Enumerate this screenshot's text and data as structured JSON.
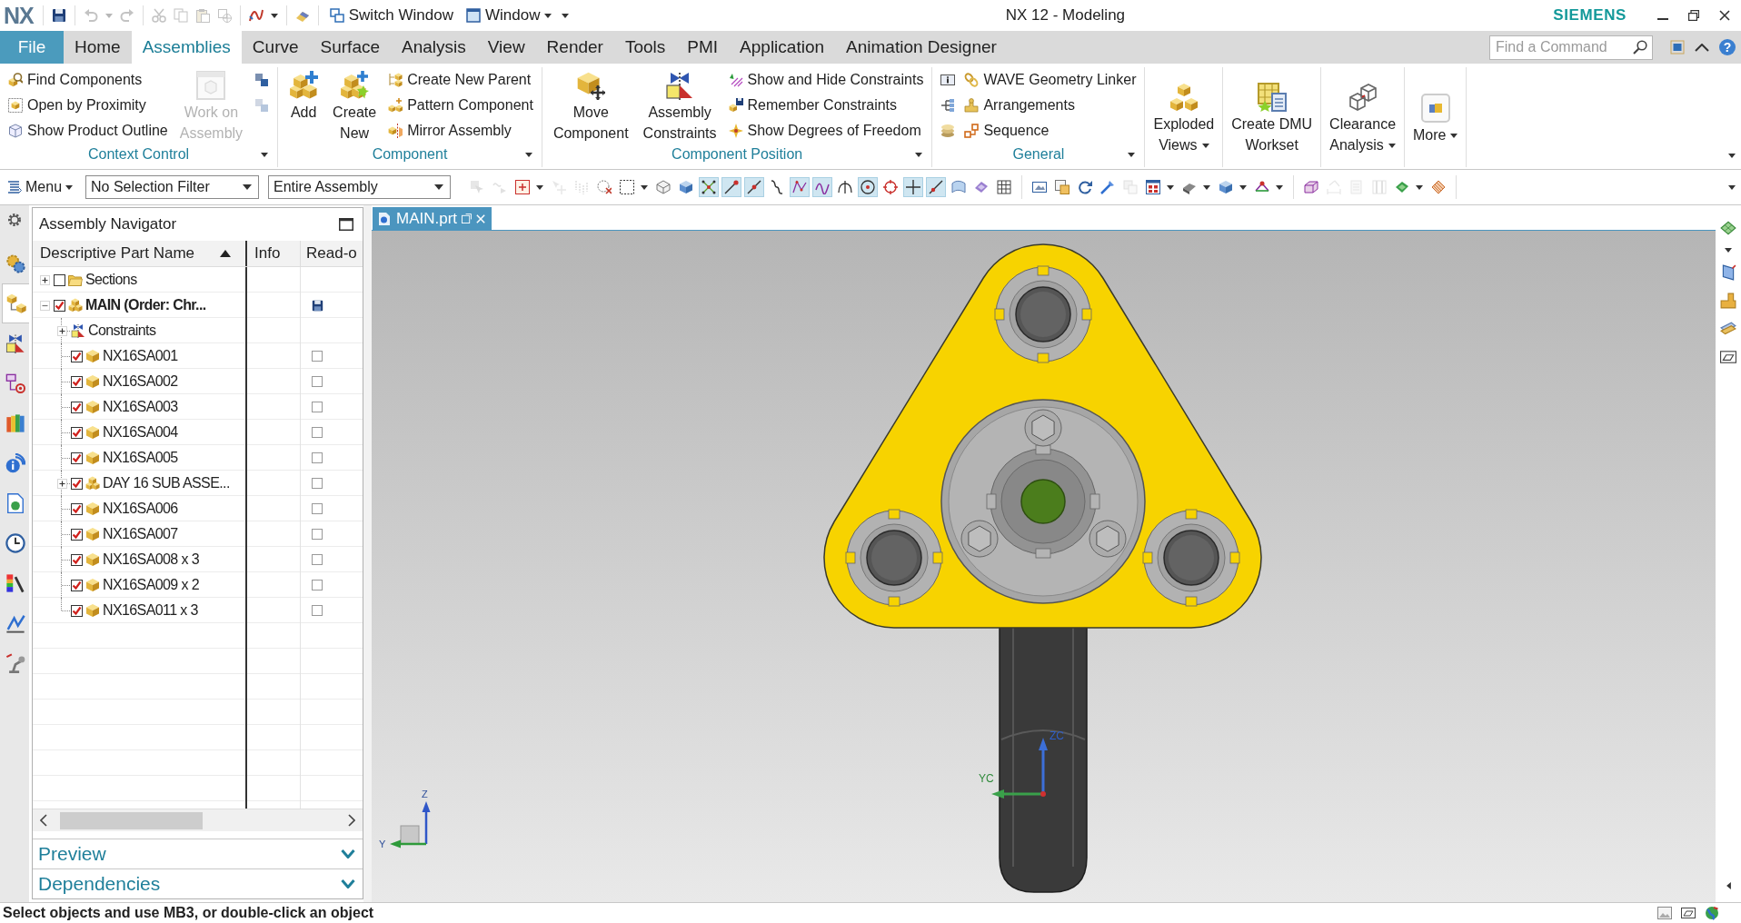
{
  "title_bar": {
    "logo": "NX",
    "quick_access": [
      {
        "tools": [
          {
            "kind": "plain",
            "disabled": false
          }
        ]
      },
      {
        "tools": [
          {
            "kind": "split",
            "disabled": true
          },
          {
            "kind": "plain",
            "disabled": true
          }
        ]
      },
      {
        "tools": [
          {
            "kind": "plain",
            "disabled": true
          },
          {
            "kind": "plain",
            "disabled": true
          },
          {
            "kind": "plain",
            "disabled": true
          },
          {
            "kind": "plain",
            "disabled": true
          }
        ]
      },
      {
        "tools": [
          {
            "kind": "split",
            "disabled": false
          }
        ]
      },
      {
        "tools": [
          {
            "kind": "plain",
            "disabled": false
          }
        ]
      }
    ],
    "window_menu": [
      {
        "label": "Switch Window",
        "kind": "plain"
      },
      {
        "label": "Window",
        "kind": "split"
      }
    ],
    "title": "NX 12 - Modeling",
    "brand": "SIEMENS"
  },
  "ribbon": {
    "tabs": [
      {
        "label": "File",
        "kind": "backstage",
        "selected": false
      },
      {
        "label": "Home",
        "kind": "tab",
        "selected": false
      },
      {
        "label": "Assemblies",
        "kind": "tab",
        "selected": true
      },
      {
        "label": "Curve",
        "kind": "tab",
        "selected": false
      },
      {
        "label": "Surface",
        "kind": "tab",
        "selected": false
      },
      {
        "label": "Analysis",
        "kind": "tab",
        "selected": false
      },
      {
        "label": "View",
        "kind": "tab",
        "selected": false
      },
      {
        "label": "Render",
        "kind": "tab",
        "selected": false
      },
      {
        "label": "Tools",
        "kind": "tab",
        "selected": false
      },
      {
        "label": "PMI",
        "kind": "tab",
        "selected": false
      },
      {
        "label": "Application",
        "kind": "tab",
        "selected": false
      },
      {
        "label": "Animation Designer",
        "kind": "tab",
        "selected": false
      }
    ],
    "search": {
      "placeholder": "Find a Command"
    },
    "help": "?",
    "groups": [
      {
        "label": "Context Control",
        "items": [
          {
            "kind": "small",
            "label": "Find Components",
            "disabled": false
          },
          {
            "kind": "small",
            "label": "Open by Proximity",
            "disabled": false
          },
          {
            "kind": "small",
            "label": "Show Product Outline",
            "disabled": false
          },
          {
            "kind": "large",
            "label": "Work on\nAssembly",
            "disabled": true
          },
          {
            "kind": "icon",
            "disabled": false
          },
          {
            "kind": "icon",
            "disabled": true
          }
        ]
      },
      {
        "label": "Component",
        "items": [
          {
            "kind": "large",
            "label": "Add",
            "disabled": false
          },
          {
            "kind": "large",
            "label": "Create\nNew",
            "disabled": false
          },
          {
            "kind": "small",
            "label": "Create New Parent",
            "disabled": false
          },
          {
            "kind": "small",
            "label": "Pattern Component",
            "disabled": false
          },
          {
            "kind": "small",
            "label": "Mirror Assembly",
            "disabled": false
          }
        ]
      },
      {
        "label": "Component Position",
        "items": [
          {
            "kind": "large",
            "label": "Move\nComponent",
            "disabled": false
          },
          {
            "kind": "large",
            "label": "Assembly\nConstraints",
            "disabled": false
          },
          {
            "kind": "small",
            "label": "Show and Hide Constraints",
            "disabled": false
          },
          {
            "kind": "small",
            "label": "Remember Constraints",
            "disabled": false
          },
          {
            "kind": "small",
            "label": "Show Degrees of Freedom",
            "disabled": false
          }
        ]
      },
      {
        "label": "General",
        "items": [
          {
            "kind": "icon",
            "disabled": false
          },
          {
            "kind": "icon",
            "disabled": false
          },
          {
            "kind": "icon",
            "disabled": false
          },
          {
            "kind": "small",
            "label": "WAVE Geometry Linker",
            "disabled": false
          },
          {
            "kind": "small",
            "label": "Arrangements",
            "disabled": false
          },
          {
            "kind": "small",
            "label": "Sequence",
            "disabled": false
          }
        ]
      }
    ],
    "large_buttons": [
      {
        "label": "Exploded\nViews",
        "menu": true
      },
      {
        "label": "Create DMU\nWorkset",
        "menu": false
      },
      {
        "label": "Clearance\nAnalysis",
        "menu": true
      },
      {
        "label": "More",
        "menu": true
      }
    ]
  },
  "toolbar": {
    "menu": "Menu",
    "filters": [
      {
        "value": "No Selection Filter"
      },
      {
        "value": "Entire Assembly"
      }
    ],
    "groups": [
      {
        "tools": [
          {
            "kind": "plain",
            "on": false,
            "disabled": true
          },
          {
            "kind": "plain",
            "on": false,
            "disabled": true
          },
          {
            "kind": "split",
            "on": false,
            "disabled": false
          },
          {
            "kind": "plain",
            "on": false,
            "disabled": true
          },
          {
            "kind": "plain",
            "on": false,
            "disabled": true
          },
          {
            "kind": "plain",
            "on": false,
            "disabled": false
          },
          {
            "kind": "split",
            "on": false,
            "disabled": false
          },
          {
            "kind": "plain",
            "on": false,
            "disabled": false
          },
          {
            "kind": "plain",
            "on": false,
            "disabled": false
          },
          {
            "kind": "plain",
            "on": true,
            "disabled": false
          },
          {
            "kind": "plain",
            "on": true,
            "disabled": false
          },
          {
            "kind": "plain",
            "on": true,
            "disabled": false
          },
          {
            "kind": "plain",
            "on": false,
            "disabled": false
          },
          {
            "kind": "plain",
            "on": true,
            "disabled": false
          },
          {
            "kind": "plain",
            "on": true,
            "disabled": false
          },
          {
            "kind": "plain",
            "on": false,
            "disabled": false
          },
          {
            "kind": "plain",
            "on": true,
            "disabled": false
          },
          {
            "kind": "plain",
            "on": false,
            "disabled": false
          },
          {
            "kind": "plain",
            "on": true,
            "disabled": false
          },
          {
            "kind": "plain",
            "on": true,
            "disabled": false
          },
          {
            "kind": "plain",
            "on": false,
            "disabled": false
          },
          {
            "kind": "plain",
            "on": false,
            "disabled": false
          },
          {
            "kind": "plain",
            "on": false,
            "disabled": false
          }
        ]
      },
      {
        "tools": [
          {
            "kind": "plain",
            "on": false,
            "disabled": false
          },
          {
            "kind": "plain",
            "on": false,
            "disabled": false
          },
          {
            "kind": "plain",
            "on": false,
            "disabled": false
          },
          {
            "kind": "plain",
            "on": false,
            "disabled": false
          },
          {
            "kind": "plain",
            "on": false,
            "disabled": true
          },
          {
            "kind": "split",
            "on": false,
            "disabled": false
          },
          {
            "kind": "split",
            "on": false,
            "disabled": false
          },
          {
            "kind": "split",
            "on": false,
            "disabled": false
          },
          {
            "kind": "split",
            "on": false,
            "disabled": false
          }
        ]
      },
      {
        "tools": [
          {
            "kind": "plain",
            "on": false,
            "disabled": false
          },
          {
            "kind": "plain",
            "on": false,
            "disabled": true
          },
          {
            "kind": "plain",
            "on": false,
            "disabled": true
          },
          {
            "kind": "plain",
            "on": false,
            "disabled": true
          },
          {
            "kind": "split",
            "on": false,
            "disabled": false
          },
          {
            "kind": "plain",
            "on": false,
            "disabled": false
          }
        ]
      }
    ]
  },
  "resource_bar": {
    "items": [
      {
        "selected": false
      },
      {
        "selected": true
      },
      {
        "selected": false
      },
      {
        "selected": false
      },
      {
        "selected": false
      },
      {
        "selected": false
      },
      {
        "selected": false
      },
      {
        "selected": false
      },
      {
        "selected": false
      },
      {
        "selected": false
      },
      {
        "selected": false
      }
    ]
  },
  "navigator": {
    "title": "Assembly Navigator",
    "columns": [
      {
        "label": "Descriptive Part Name",
        "sorted": true
      },
      {
        "label": "Info",
        "sorted": false
      },
      {
        "label": "Read-o",
        "sorted": false
      }
    ],
    "tree": [
      {
        "name": "Sections",
        "kind": "folder",
        "checked": false,
        "expanded": false,
        "work_part": false
      },
      {
        "name": "MAIN (Order: Chr...",
        "kind": "assembly",
        "checked": true,
        "expanded": true,
        "work_part": true,
        "modified": true,
        "children": [
          {
            "name": "Constraints",
            "kind": "constraints",
            "expanded": false,
            "work_part": false
          },
          {
            "name": "NX16SA001",
            "kind": "part",
            "checked": true,
            "work_part": false,
            "modified": false
          },
          {
            "name": "NX16SA002",
            "kind": "part",
            "checked": true,
            "work_part": false,
            "modified": false
          },
          {
            "name": "NX16SA003",
            "kind": "part",
            "checked": true,
            "work_part": false,
            "modified": false
          },
          {
            "name": "NX16SA004",
            "kind": "part",
            "checked": true,
            "work_part": false,
            "modified": false
          },
          {
            "name": "NX16SA005",
            "kind": "part",
            "checked": true,
            "work_part": false,
            "modified": false
          },
          {
            "name": "DAY 16 SUB ASSE...",
            "kind": "assembly",
            "checked": true,
            "expanded": false,
            "work_part": false,
            "modified": false
          },
          {
            "name": "NX16SA006",
            "kind": "part",
            "checked": true,
            "work_part": false,
            "modified": false
          },
          {
            "name": "NX16SA007",
            "kind": "part",
            "checked": true,
            "work_part": false,
            "modified": false
          },
          {
            "name": "NX16SA008 x 3",
            "kind": "part",
            "checked": true,
            "work_part": false,
            "modified": false
          },
          {
            "name": "NX16SA009 x 2",
            "kind": "part",
            "checked": true,
            "work_part": false,
            "modified": false
          },
          {
            "name": "NX16SA011 x 3",
            "kind": "part",
            "checked": true,
            "work_part": false,
            "modified": false
          }
        ]
      }
    ],
    "panels": [
      {
        "label": "Preview",
        "expanded": false
      },
      {
        "label": "Dependencies",
        "expanded": false
      }
    ]
  },
  "viewport": {
    "tabs": [
      {
        "label": "MAIN.prt",
        "selected": true
      }
    ],
    "triad": {
      "labels": [
        "Z",
        "Y"
      ]
    },
    "wcs": {
      "labels": [
        "ZC",
        "YC"
      ]
    }
  },
  "status_bar": {
    "message": "Select objects and use MB3, or double-click an object"
  }
}
